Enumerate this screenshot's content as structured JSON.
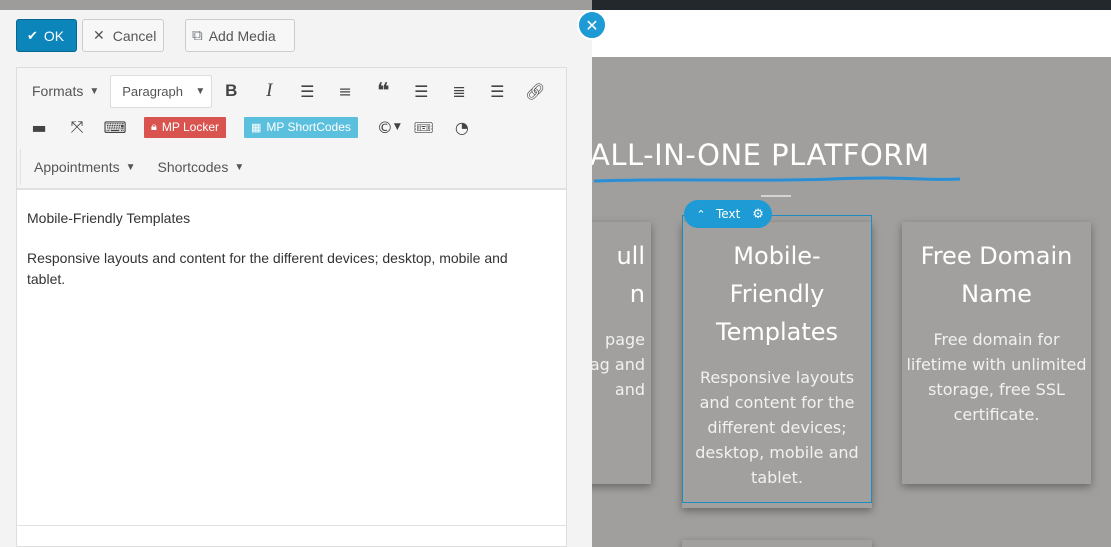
{
  "modal": {
    "buttons": {
      "ok": "OK",
      "cancel": "Cancel",
      "add_media": "Add Media"
    },
    "toolbar": {
      "formats": "Formats",
      "paragraph": "Paragraph",
      "bold": "B",
      "italic": "I",
      "mp_locker": "MP Locker",
      "mp_shortcodes": "MP ShortCodes",
      "appointments": "Appointments",
      "shortcodes": "Shortcodes"
    },
    "content": {
      "heading": "Mobile-Friendly Templates",
      "body": "Responsive layouts and content for the different devices; desktop, mobile and tablet."
    }
  },
  "page": {
    "hero_title": "ALL-IN-ONE PLATFORM",
    "cards": [
      {
        "title_lines": [
          "ull",
          "n"
        ],
        "text_lines": [
          "page",
          "ag and",
          "and"
        ]
      },
      {
        "title": "Mobile-Friendly Templates",
        "text": "Responsive layouts and content for the different devices; desktop, mobile and tablet."
      },
      {
        "title": "Free Domain Name",
        "text": "Free domain for lifetime with unlimited storage, free SSL certificate."
      }
    ],
    "element_chip": "Text"
  },
  "colors": {
    "primary": "#0b85ba",
    "accent": "#1e9ad4",
    "locker": "#d9534f",
    "shortcodes": "#5bc0de"
  }
}
